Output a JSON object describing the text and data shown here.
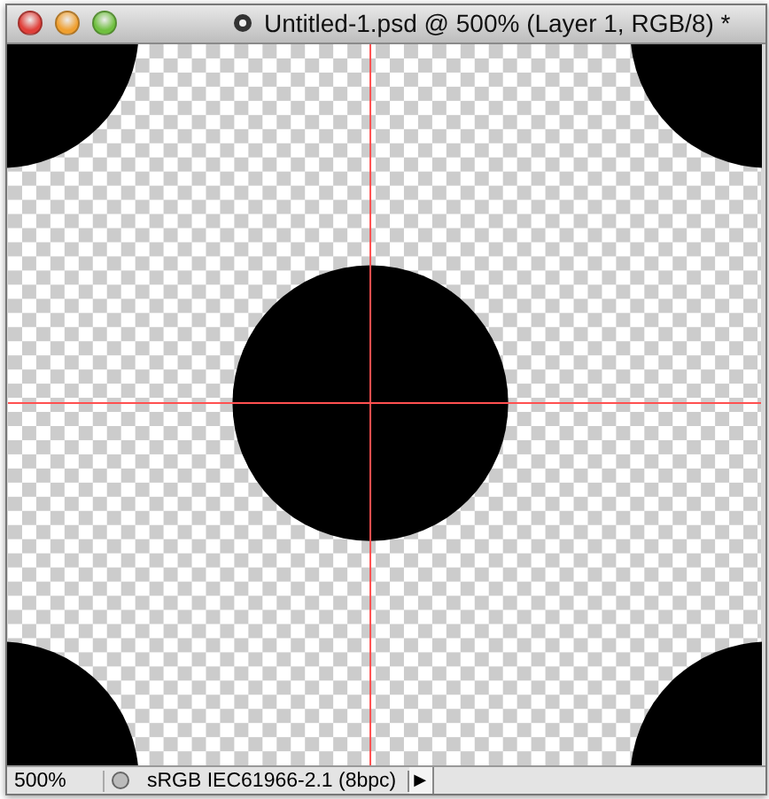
{
  "window": {
    "title": "Untitled-1.psd @ 500% (Layer 1, RGB/8) *"
  },
  "status_bar": {
    "zoom": "500%",
    "document_profile": "sRGB IEC61966-2.1 (8bpc)",
    "menu_arrow": "▶"
  }
}
